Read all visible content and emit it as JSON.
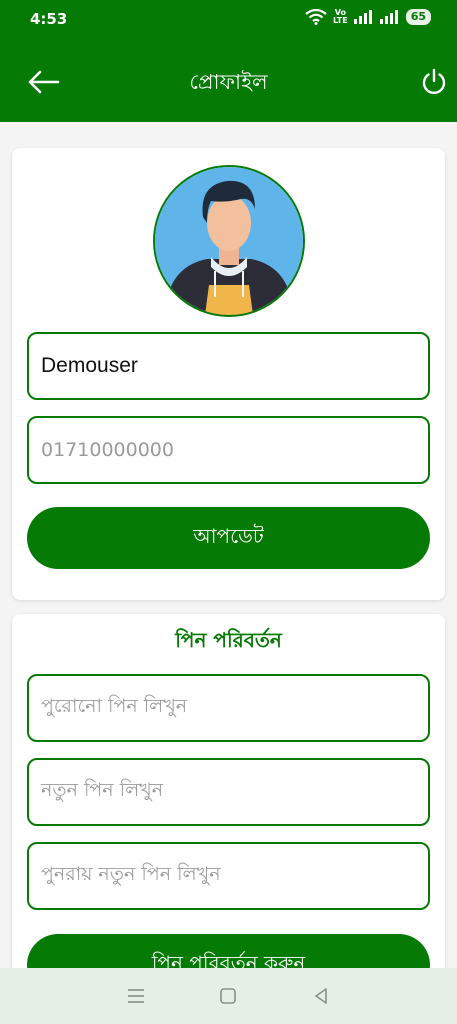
{
  "status_bar": {
    "time": "4:53",
    "network_label_top": "Vo",
    "network_label_bottom": "LTE",
    "battery": "65",
    "icons": [
      "wifi-icon",
      "signal-icon",
      "signal-icon",
      "battery-icon"
    ]
  },
  "app_bar": {
    "title": "প্রোফাইল",
    "back_icon": "back-arrow-icon",
    "power_icon": "power-icon",
    "color": "#057a05"
  },
  "profile": {
    "name_value": "Demouser",
    "phone_placeholder": "01710000000",
    "update_button": "আপডেট"
  },
  "pin_change": {
    "title": "পিন পরিবর্তন",
    "old_pin_placeholder": "পুরোনো পিন লিখুন",
    "new_pin_placeholder": "নতুন পিন লিখুন",
    "confirm_pin_placeholder": "পুনরায় নতুন পিন লিখুন",
    "submit_button": "পিন পরিবর্তন করুন"
  },
  "nav_bar": {
    "icons": [
      "menu-icon",
      "home-icon",
      "back-icon"
    ]
  }
}
